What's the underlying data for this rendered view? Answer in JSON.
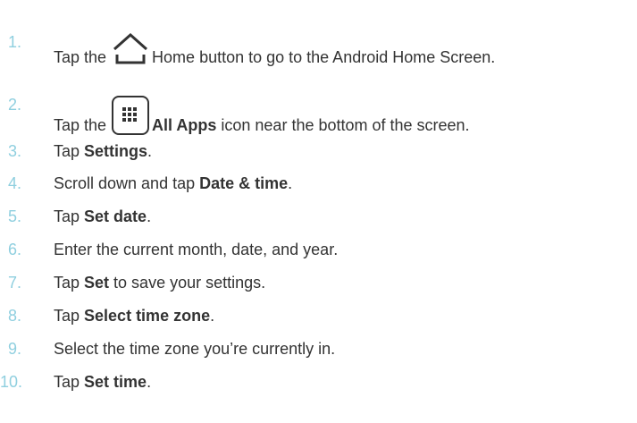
{
  "steps": [
    {
      "num": "1.",
      "pre": "Tap the ",
      "icon": "home-icon",
      "bold": "",
      "post": "Home button to go to the Android Home Screen."
    },
    {
      "num": "2.",
      "pre": "Tap the ",
      "icon": "all-apps-icon",
      "bold": "All Apps",
      "post": " icon near the bottom of the screen."
    },
    {
      "num": "3.",
      "pre": "Tap ",
      "bold": "Settings",
      "post": "."
    },
    {
      "num": "4.",
      "pre": "Scroll down and tap ",
      "bold": "Date & time",
      "post": "."
    },
    {
      "num": "5.",
      "pre": "Tap ",
      "bold": "Set date",
      "post": "."
    },
    {
      "num": "6.",
      "pre": "Enter the current month, date, and year.",
      "bold": "",
      "post": ""
    },
    {
      "num": "7.",
      "pre": "Tap ",
      "bold": "Set",
      "post": " to save your settings."
    },
    {
      "num": "8.",
      "pre": "Tap ",
      "bold": "Select time zone",
      "post": "."
    },
    {
      "num": "9.",
      "pre": "Select the time zone you’re currently in.",
      "bold": "",
      "post": ""
    },
    {
      "num": "10.",
      "pre": "Tap ",
      "bold": "Set time",
      "post": "."
    }
  ],
  "colors": {
    "number": "#8fcfdf",
    "text": "#333333"
  }
}
